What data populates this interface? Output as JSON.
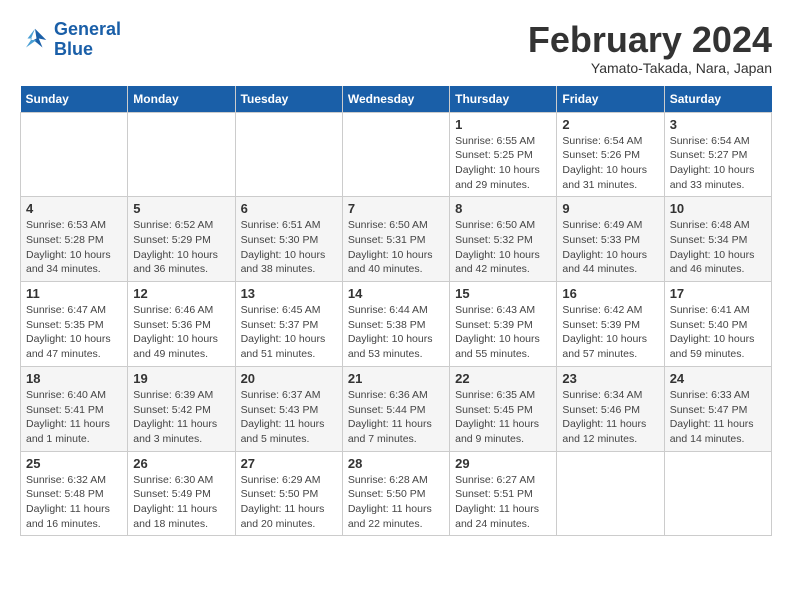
{
  "logo": {
    "line1": "General",
    "line2": "Blue"
  },
  "title": "February 2024",
  "location": "Yamato-Takada, Nara, Japan",
  "days_of_week": [
    "Sunday",
    "Monday",
    "Tuesday",
    "Wednesday",
    "Thursday",
    "Friday",
    "Saturday"
  ],
  "weeks": [
    [
      {
        "num": "",
        "sunrise": "",
        "sunset": "",
        "daylight": ""
      },
      {
        "num": "",
        "sunrise": "",
        "sunset": "",
        "daylight": ""
      },
      {
        "num": "",
        "sunrise": "",
        "sunset": "",
        "daylight": ""
      },
      {
        "num": "",
        "sunrise": "",
        "sunset": "",
        "daylight": ""
      },
      {
        "num": "1",
        "sunrise": "Sunrise: 6:55 AM",
        "sunset": "Sunset: 5:25 PM",
        "daylight": "Daylight: 10 hours and 29 minutes."
      },
      {
        "num": "2",
        "sunrise": "Sunrise: 6:54 AM",
        "sunset": "Sunset: 5:26 PM",
        "daylight": "Daylight: 10 hours and 31 minutes."
      },
      {
        "num": "3",
        "sunrise": "Sunrise: 6:54 AM",
        "sunset": "Sunset: 5:27 PM",
        "daylight": "Daylight: 10 hours and 33 minutes."
      }
    ],
    [
      {
        "num": "4",
        "sunrise": "Sunrise: 6:53 AM",
        "sunset": "Sunset: 5:28 PM",
        "daylight": "Daylight: 10 hours and 34 minutes."
      },
      {
        "num": "5",
        "sunrise": "Sunrise: 6:52 AM",
        "sunset": "Sunset: 5:29 PM",
        "daylight": "Daylight: 10 hours and 36 minutes."
      },
      {
        "num": "6",
        "sunrise": "Sunrise: 6:51 AM",
        "sunset": "Sunset: 5:30 PM",
        "daylight": "Daylight: 10 hours and 38 minutes."
      },
      {
        "num": "7",
        "sunrise": "Sunrise: 6:50 AM",
        "sunset": "Sunset: 5:31 PM",
        "daylight": "Daylight: 10 hours and 40 minutes."
      },
      {
        "num": "8",
        "sunrise": "Sunrise: 6:50 AM",
        "sunset": "Sunset: 5:32 PM",
        "daylight": "Daylight: 10 hours and 42 minutes."
      },
      {
        "num": "9",
        "sunrise": "Sunrise: 6:49 AM",
        "sunset": "Sunset: 5:33 PM",
        "daylight": "Daylight: 10 hours and 44 minutes."
      },
      {
        "num": "10",
        "sunrise": "Sunrise: 6:48 AM",
        "sunset": "Sunset: 5:34 PM",
        "daylight": "Daylight: 10 hours and 46 minutes."
      }
    ],
    [
      {
        "num": "11",
        "sunrise": "Sunrise: 6:47 AM",
        "sunset": "Sunset: 5:35 PM",
        "daylight": "Daylight: 10 hours and 47 minutes."
      },
      {
        "num": "12",
        "sunrise": "Sunrise: 6:46 AM",
        "sunset": "Sunset: 5:36 PM",
        "daylight": "Daylight: 10 hours and 49 minutes."
      },
      {
        "num": "13",
        "sunrise": "Sunrise: 6:45 AM",
        "sunset": "Sunset: 5:37 PM",
        "daylight": "Daylight: 10 hours and 51 minutes."
      },
      {
        "num": "14",
        "sunrise": "Sunrise: 6:44 AM",
        "sunset": "Sunset: 5:38 PM",
        "daylight": "Daylight: 10 hours and 53 minutes."
      },
      {
        "num": "15",
        "sunrise": "Sunrise: 6:43 AM",
        "sunset": "Sunset: 5:39 PM",
        "daylight": "Daylight: 10 hours and 55 minutes."
      },
      {
        "num": "16",
        "sunrise": "Sunrise: 6:42 AM",
        "sunset": "Sunset: 5:39 PM",
        "daylight": "Daylight: 10 hours and 57 minutes."
      },
      {
        "num": "17",
        "sunrise": "Sunrise: 6:41 AM",
        "sunset": "Sunset: 5:40 PM",
        "daylight": "Daylight: 10 hours and 59 minutes."
      }
    ],
    [
      {
        "num": "18",
        "sunrise": "Sunrise: 6:40 AM",
        "sunset": "Sunset: 5:41 PM",
        "daylight": "Daylight: 11 hours and 1 minute."
      },
      {
        "num": "19",
        "sunrise": "Sunrise: 6:39 AM",
        "sunset": "Sunset: 5:42 PM",
        "daylight": "Daylight: 11 hours and 3 minutes."
      },
      {
        "num": "20",
        "sunrise": "Sunrise: 6:37 AM",
        "sunset": "Sunset: 5:43 PM",
        "daylight": "Daylight: 11 hours and 5 minutes."
      },
      {
        "num": "21",
        "sunrise": "Sunrise: 6:36 AM",
        "sunset": "Sunset: 5:44 PM",
        "daylight": "Daylight: 11 hours and 7 minutes."
      },
      {
        "num": "22",
        "sunrise": "Sunrise: 6:35 AM",
        "sunset": "Sunset: 5:45 PM",
        "daylight": "Daylight: 11 hours and 9 minutes."
      },
      {
        "num": "23",
        "sunrise": "Sunrise: 6:34 AM",
        "sunset": "Sunset: 5:46 PM",
        "daylight": "Daylight: 11 hours and 12 minutes."
      },
      {
        "num": "24",
        "sunrise": "Sunrise: 6:33 AM",
        "sunset": "Sunset: 5:47 PM",
        "daylight": "Daylight: 11 hours and 14 minutes."
      }
    ],
    [
      {
        "num": "25",
        "sunrise": "Sunrise: 6:32 AM",
        "sunset": "Sunset: 5:48 PM",
        "daylight": "Daylight: 11 hours and 16 minutes."
      },
      {
        "num": "26",
        "sunrise": "Sunrise: 6:30 AM",
        "sunset": "Sunset: 5:49 PM",
        "daylight": "Daylight: 11 hours and 18 minutes."
      },
      {
        "num": "27",
        "sunrise": "Sunrise: 6:29 AM",
        "sunset": "Sunset: 5:50 PM",
        "daylight": "Daylight: 11 hours and 20 minutes."
      },
      {
        "num": "28",
        "sunrise": "Sunrise: 6:28 AM",
        "sunset": "Sunset: 5:50 PM",
        "daylight": "Daylight: 11 hours and 22 minutes."
      },
      {
        "num": "29",
        "sunrise": "Sunrise: 6:27 AM",
        "sunset": "Sunset: 5:51 PM",
        "daylight": "Daylight: 11 hours and 24 minutes."
      },
      {
        "num": "",
        "sunrise": "",
        "sunset": "",
        "daylight": ""
      },
      {
        "num": "",
        "sunrise": "",
        "sunset": "",
        "daylight": ""
      }
    ]
  ]
}
